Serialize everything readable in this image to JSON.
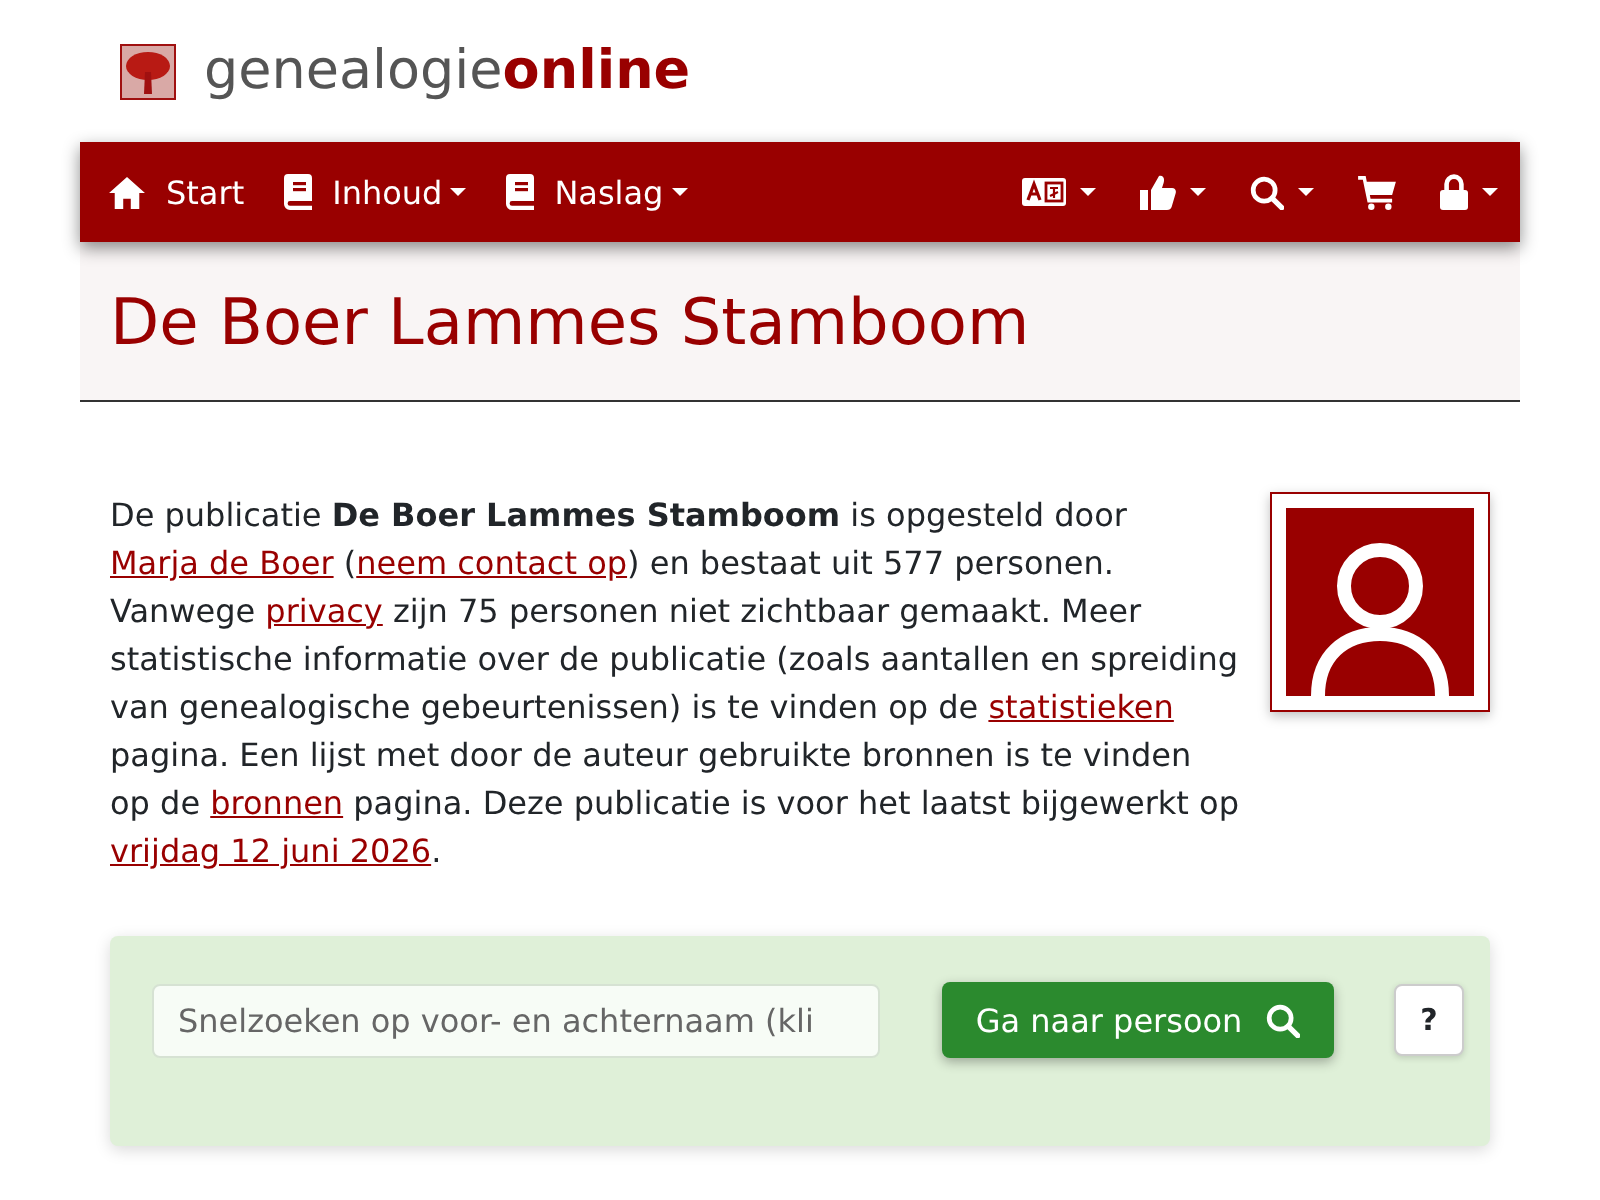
{
  "brand": {
    "light": "genealogie",
    "bold": "online"
  },
  "navbar": {
    "left": [
      {
        "kind": "home",
        "label": "Start",
        "dropdown": false
      },
      {
        "kind": "book",
        "label": "Inhoud",
        "dropdown": true
      },
      {
        "kind": "book",
        "label": "Naslag",
        "dropdown": true
      }
    ],
    "right": [
      {
        "kind": "language",
        "dropdown": true
      },
      {
        "kind": "like",
        "dropdown": true
      },
      {
        "kind": "search",
        "dropdown": true
      },
      {
        "kind": "cart",
        "dropdown": false
      },
      {
        "kind": "lock",
        "dropdown": true
      }
    ]
  },
  "title": "De Boer Lammes Stamboom",
  "intro": [
    {
      "kind": "text",
      "text": "De publicatie **De Boer Lammes Stamboom** is opgesteld door "
    },
    {
      "kind": "link",
      "text": "Marja de Boer"
    },
    {
      "kind": "text",
      "text": " ("
    },
    {
      "kind": "link",
      "text": "neem contact op"
    },
    {
      "kind": "text",
      "text": ") en bestaat uit 577 personen. Vanwege "
    },
    {
      "kind": "link",
      "text": "privacy"
    },
    {
      "kind": "text",
      "text": " zijn 75 personen niet zichtbaar gemaakt. Meer statistische informatie over de publicatie (zoals aantallen en spreiding van genealogische gebeurtenissen) is te vinden op de "
    },
    {
      "kind": "link",
      "text": "statistieken"
    },
    {
      "kind": "text",
      "text": " pagina. Een lijst met door de auteur gebruikte bronnen is te vinden op de "
    },
    {
      "kind": "link",
      "text": "bronnen"
    },
    {
      "kind": "text",
      "text": " pagina. Deze publicatie is voor het laatst bijgewerkt op "
    },
    {
      "kind": "link",
      "text": "vrijdag 12 juni 2026"
    },
    {
      "kind": "text",
      "text": "."
    }
  ],
  "quick_search": {
    "placeholder": "Snelzoeken op voor- en achternaam (kli",
    "button": "Ga naar persoon",
    "help": "?"
  }
}
